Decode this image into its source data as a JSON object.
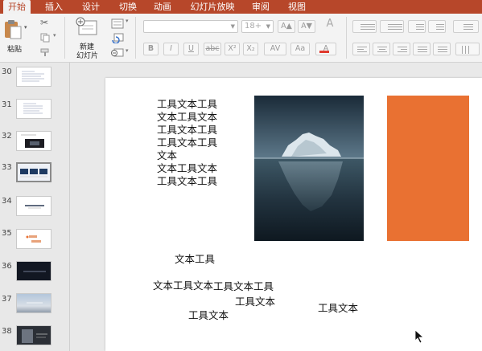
{
  "tabs": [
    {
      "label": "开始",
      "active": true
    },
    {
      "label": "插入"
    },
    {
      "label": "设计"
    },
    {
      "label": "切换"
    },
    {
      "label": "动画"
    },
    {
      "label": "幻灯片放映"
    },
    {
      "label": "审阅"
    },
    {
      "label": "视图"
    }
  ],
  "ribbon": {
    "paste_label": "粘贴",
    "new_slide_label_line1": "新建",
    "new_slide_label_line2": "幻灯片",
    "font_name_value": "",
    "font_size_value": "18+",
    "format_buttons": [
      "B",
      "I",
      "U",
      "abc",
      "X²",
      "X₂"
    ],
    "grow_font": "A▲",
    "shrink_font": "A▼",
    "spacing_label": "AV",
    "case_label": "Aa",
    "clear_format": "A"
  },
  "colors": {
    "tab_bar": "#b7472a",
    "accent_orange": "#e97132",
    "font_color_swatch": "#e03a2e"
  },
  "thumbnails": [
    {
      "number": "30",
      "style": "text"
    },
    {
      "number": "31",
      "style": "text"
    },
    {
      "number": "32",
      "style": "dark-center"
    },
    {
      "number": "33",
      "style": "blue-blocks"
    },
    {
      "number": "34",
      "style": "line"
    },
    {
      "number": "35",
      "style": "orange-text"
    },
    {
      "number": "36",
      "style": "dark"
    },
    {
      "number": "37",
      "style": "sky"
    },
    {
      "number": "38",
      "style": "dark-photo"
    }
  ],
  "slide": {
    "text_block_main": "工具文本工具\n文本工具文本\n工具文本工具\n工具文本工具\n文本\n文本工具文本\n工具文本工具",
    "text_1": "文本工具",
    "text_2": "文本工具文本",
    "text_3": "工具文本工具",
    "text_4": "工具文本",
    "text_5": "工具文本",
    "text_6": "工具文本",
    "image_alt": "iceberg",
    "rect_color": "#e97132"
  }
}
